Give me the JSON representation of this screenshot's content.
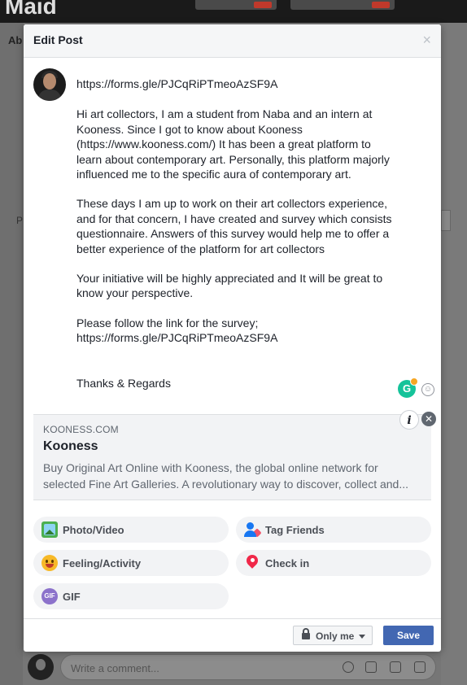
{
  "background": {
    "profile_name": "Maid",
    "about_tab": "Ab",
    "left_letter": "P",
    "comment_placeholder": "Write a comment..."
  },
  "modal": {
    "title": "Edit Post",
    "close_symbol": "×"
  },
  "post": {
    "link_line": "https://forms.gle/PJCqRiPTmeoAzSF9A",
    "paragraph1": "Hi art collectors, I am a student from Naba and an intern at\nKooness. Since I got to know about Kooness\n(https://www.kooness.com/) It has been a great platform to\nlearn about contemporary art. Personally, this platform majorly\ninfluenced me to the specific aura of contemporary art.",
    "paragraph2": "These days I am up to work on their art collectors experience,\nand for that concern, I have created and survey which consists\nquestionnaire. Answers of this survey would help me to offer a\nbetter experience of the platform for art collectors",
    "paragraph3": "Your initiative will be highly appreciated and It will be great to\nknow your perspective.",
    "paragraph4": "Please follow the link for the survey;\nhttps://forms.gle/PJCqRiPTmeoAzSF9A",
    "sign_off": "Thanks & Regards"
  },
  "grammarly_letter": "G",
  "link_preview": {
    "domain": "KOONESS.COM",
    "title": "Kooness",
    "description_line1": "Buy Original Art Online with Kooness, the global online network for",
    "description_line2": "selected Fine Art Galleries. A revolutionary way to discover, collect and...",
    "info_symbol": "i",
    "remove_symbol": "✕"
  },
  "actions": {
    "photo_video": "Photo/Video",
    "tag_friends": "Tag Friends",
    "feeling_activity": "Feeling/Activity",
    "check_in": "Check in",
    "gif": "GIF",
    "gif_icon_text": "GIF"
  },
  "footer": {
    "privacy_label": "Only me",
    "save_label": "Save"
  }
}
